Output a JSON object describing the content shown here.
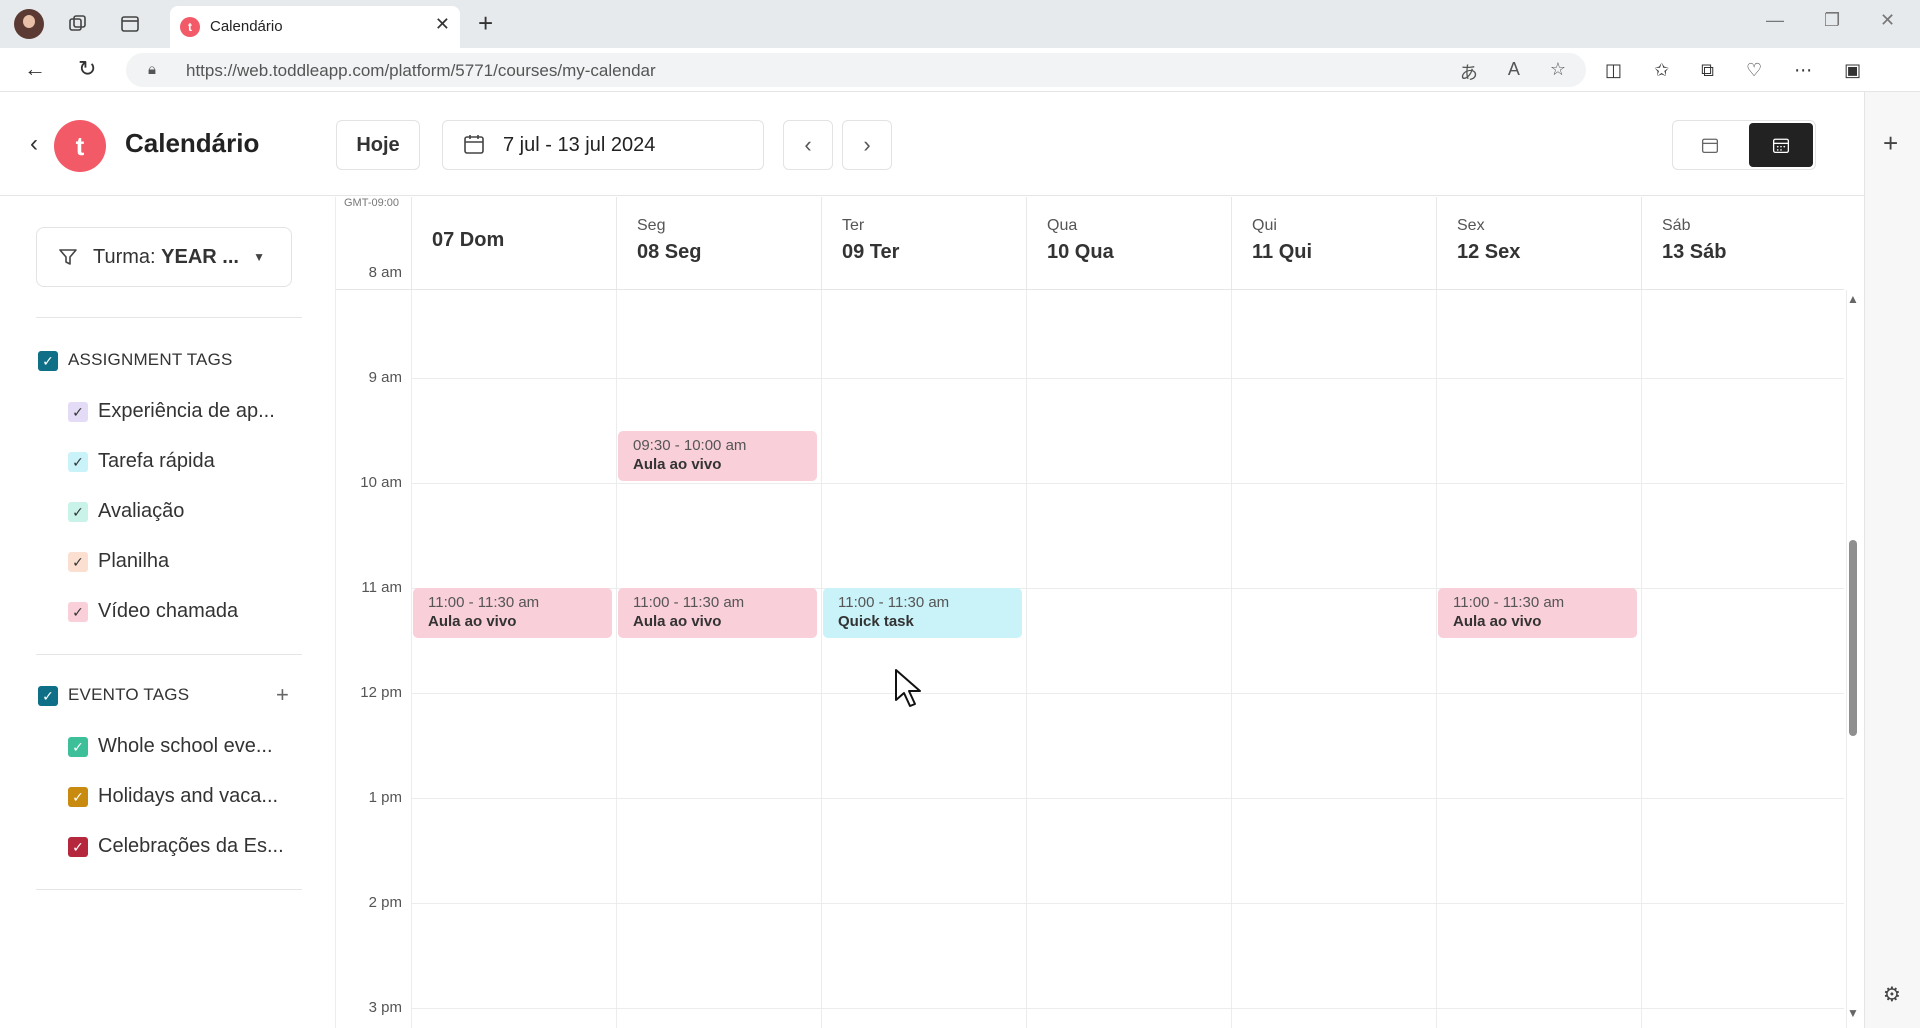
{
  "browser": {
    "tab_title": "Calendário",
    "favicon_letter": "t",
    "url": "https://web.toddleapp.com/platform/5771/courses/my-calendar"
  },
  "header": {
    "logo_letter": "t",
    "title": "Calendário",
    "today_label": "Hoje",
    "date_range": "7 jul - 13 jul 2024",
    "active_view": "week"
  },
  "sidebar": {
    "filter_label": "Turma:",
    "filter_value": "YEAR ...",
    "assignment_group": {
      "label": "ASSIGNMENT TAGS",
      "checked": true,
      "items": [
        {
          "label": "Experiência de ap...",
          "color": "#e4dcf7"
        },
        {
          "label": "Tarefa rápida",
          "color": "#c9f2f9"
        },
        {
          "label": "Avaliação",
          "color": "#c9f3e8"
        },
        {
          "label": "Planilha",
          "color": "#fbe0d2"
        },
        {
          "label": "Vídeo chamada",
          "color": "#f9cfd9"
        }
      ]
    },
    "event_group": {
      "label": "EVENTO TAGS",
      "checked": true,
      "items": [
        {
          "label": "Whole school eve...",
          "color": "#3dbf9a"
        },
        {
          "label": "Holidays and vaca...",
          "color": "#c98a10"
        },
        {
          "label": "Celebrações da Es...",
          "color": "#b5273d"
        }
      ]
    }
  },
  "calendar": {
    "timezone": "GMT-09:00",
    "days": [
      {
        "small": "",
        "big": "07 Dom"
      },
      {
        "small": "Seg",
        "big": "08 Seg"
      },
      {
        "small": "Ter",
        "big": "09 Ter"
      },
      {
        "small": "Qua",
        "big": "10 Qua"
      },
      {
        "small": "Qui",
        "big": "11 Qui"
      },
      {
        "small": "Sex",
        "big": "12 Sex"
      },
      {
        "small": "Sáb",
        "big": "13 Sáb"
      }
    ],
    "hours": [
      "8 am",
      "9 am",
      "10 am",
      "11 am",
      "12 pm",
      "1 pm",
      "2 pm",
      "3 pm"
    ],
    "events": [
      {
        "day": 1,
        "time": "09:30 - 10:00 am",
        "title": "Aula ao vivo",
        "color": "pink"
      },
      {
        "day": 0,
        "time": "11:00 - 11:30 am",
        "title": "Aula ao vivo",
        "color": "pink"
      },
      {
        "day": 1,
        "time": "11:00 - 11:30 am",
        "title": "Aula ao vivo",
        "color": "pink"
      },
      {
        "day": 2,
        "time": "11:00 - 11:30 am",
        "title": "Quick task",
        "color": "cyan"
      },
      {
        "day": 5,
        "time": "11:00 - 11:30 am",
        "title": "Aula ao vivo",
        "color": "pink"
      }
    ]
  }
}
